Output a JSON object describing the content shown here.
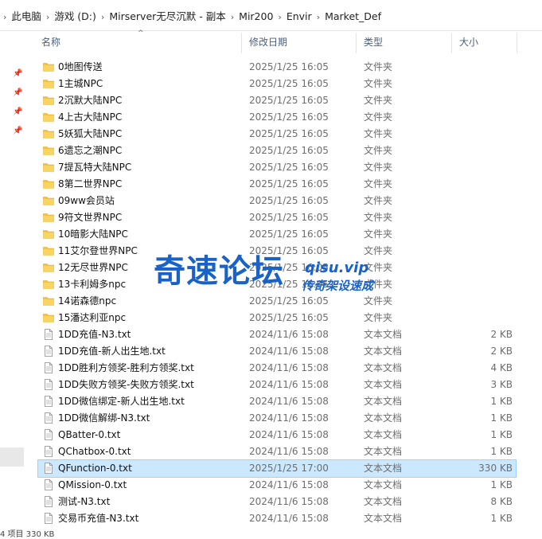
{
  "breadcrumb": [
    "此电脑",
    "游戏 (D:)",
    "Mirserver无尽沉默 - 副本",
    "Mir200",
    "Envir",
    "Market_Def"
  ],
  "columns": {
    "name": "名称",
    "date": "修改日期",
    "type": "类型",
    "size": "大小"
  },
  "rows": [
    {
      "name": "0地图传送",
      "date": "2025/1/25 16:05",
      "type": "文件夹",
      "size": "",
      "kind": "folder"
    },
    {
      "name": "1主城NPC",
      "date": "2025/1/25 16:05",
      "type": "文件夹",
      "size": "",
      "kind": "folder"
    },
    {
      "name": "2沉默大陆NPC",
      "date": "2025/1/25 16:05",
      "type": "文件夹",
      "size": "",
      "kind": "folder"
    },
    {
      "name": "4上古大陆NPC",
      "date": "2025/1/25 16:05",
      "type": "文件夹",
      "size": "",
      "kind": "folder"
    },
    {
      "name": "5妖狐大陆NPC",
      "date": "2025/1/25 16:05",
      "type": "文件夹",
      "size": "",
      "kind": "folder"
    },
    {
      "name": "6遗忘之潮NPC",
      "date": "2025/1/25 16:05",
      "type": "文件夹",
      "size": "",
      "kind": "folder"
    },
    {
      "name": "7提瓦特大陆NPC",
      "date": "2025/1/25 16:05",
      "type": "文件夹",
      "size": "",
      "kind": "folder"
    },
    {
      "name": "8第二世界NPC",
      "date": "2025/1/25 16:05",
      "type": "文件夹",
      "size": "",
      "kind": "folder"
    },
    {
      "name": "09ww会员站",
      "date": "2025/1/25 16:05",
      "type": "文件夹",
      "size": "",
      "kind": "folder"
    },
    {
      "name": "9符文世界NPC",
      "date": "2025/1/25 16:05",
      "type": "文件夹",
      "size": "",
      "kind": "folder"
    },
    {
      "name": "10暗影大陆NPC",
      "date": "2025/1/25 16:05",
      "type": "文件夹",
      "size": "",
      "kind": "folder"
    },
    {
      "name": "11艾尔登世界NPC",
      "date": "2025/1/25 16:05",
      "type": "文件夹",
      "size": "",
      "kind": "folder"
    },
    {
      "name": "12无尽世界NPC",
      "date": "2025/1/25 16:05",
      "type": "文件夹",
      "size": "",
      "kind": "folder"
    },
    {
      "name": "13卡利姆多npc",
      "date": "2025/1/25 16:05",
      "type": "文件夹",
      "size": "",
      "kind": "folder"
    },
    {
      "name": "14诺森德npc",
      "date": "2025/1/25 16:05",
      "type": "文件夹",
      "size": "",
      "kind": "folder"
    },
    {
      "name": "15潘达利亚npc",
      "date": "2025/1/25 16:05",
      "type": "文件夹",
      "size": "",
      "kind": "folder"
    },
    {
      "name": "1DD充值-N3.txt",
      "date": "2024/11/6 15:08",
      "type": "文本文档",
      "size": "2 KB",
      "kind": "file"
    },
    {
      "name": "1DD充值-新人出生地.txt",
      "date": "2024/11/6 15:08",
      "type": "文本文档",
      "size": "2 KB",
      "kind": "file"
    },
    {
      "name": "1DD胜利方领奖-胜利方领奖.txt",
      "date": "2024/11/6 15:08",
      "type": "文本文档",
      "size": "4 KB",
      "kind": "file"
    },
    {
      "name": "1DD失败方领奖-失败方领奖.txt",
      "date": "2024/11/6 15:08",
      "type": "文本文档",
      "size": "3 KB",
      "kind": "file"
    },
    {
      "name": "1DD微信绑定-新人出生地.txt",
      "date": "2024/11/6 15:08",
      "type": "文本文档",
      "size": "1 KB",
      "kind": "file"
    },
    {
      "name": "1DD微信解绑-N3.txt",
      "date": "2024/11/6 15:08",
      "type": "文本文档",
      "size": "1 KB",
      "kind": "file"
    },
    {
      "name": "QBatter-0.txt",
      "date": "2024/11/6 15:08",
      "type": "文本文档",
      "size": "1 KB",
      "kind": "file"
    },
    {
      "name": "QChatbox-0.txt",
      "date": "2024/11/6 15:08",
      "type": "文本文档",
      "size": "1 KB",
      "kind": "file"
    },
    {
      "name": "QFunction-0.txt",
      "date": "2025/1/25 17:00",
      "type": "文本文档",
      "size": "330 KB",
      "kind": "file",
      "selected": true
    },
    {
      "name": "QMission-0.txt",
      "date": "2024/11/6 15:08",
      "type": "文本文档",
      "size": "1 KB",
      "kind": "file"
    },
    {
      "name": "测试-N3.txt",
      "date": "2024/11/6 15:08",
      "type": "文本文档",
      "size": "8 KB",
      "kind": "file"
    },
    {
      "name": "交易币充值-N3.txt",
      "date": "2024/11/6 15:08",
      "type": "文本文档",
      "size": "1 KB",
      "kind": "file"
    }
  ],
  "watermark": {
    "title": "奇速论坛",
    "url": "qisu.vip",
    "subtitle": "传奇架设速成"
  },
  "status_bar": "4 项目 330 KB",
  "colors": {
    "folder": "#f3c443",
    "selected_bg": "#cce8ff",
    "watermark": "#1b62c7"
  }
}
